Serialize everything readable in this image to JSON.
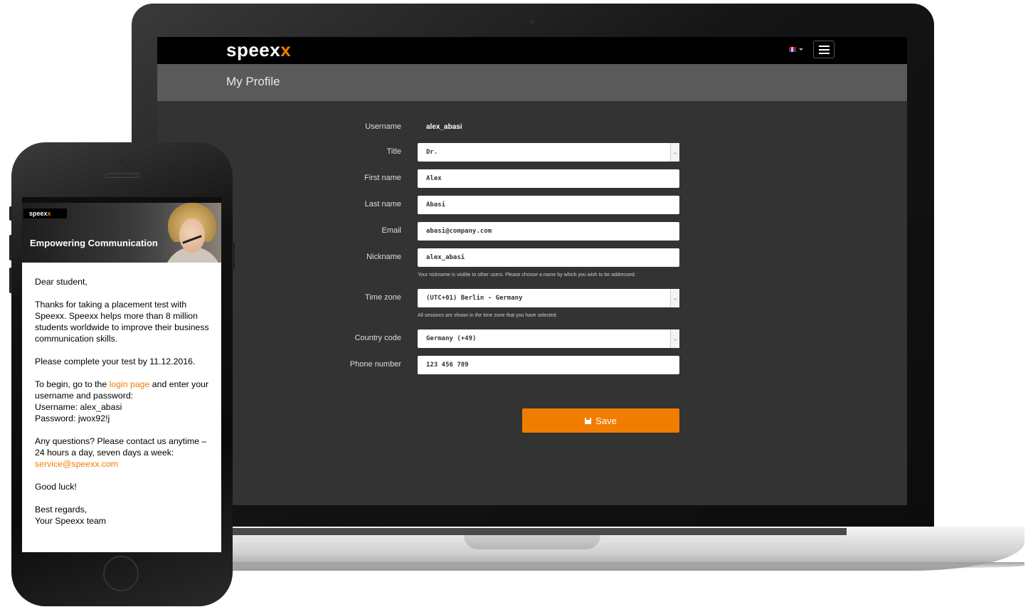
{
  "laptop": {
    "brand_logo": "speexx",
    "brand_logo_main": "speex",
    "brand_logo_accent": "x",
    "language_flag": "uk-flag-icon",
    "menu_icon": "hamburger-icon",
    "page_title": "My Profile",
    "form": {
      "username_label": "Username",
      "username_value": "alex_abasi",
      "title_label": "Title",
      "title_value": "Dr.",
      "first_name_label": "First name",
      "first_name_value": "Alex",
      "last_name_label": "Last name",
      "last_name_value": "Abasi",
      "email_label": "Email",
      "email_value": "abasi@company.com",
      "nickname_label": "Nickname",
      "nickname_value": "alex_abasi",
      "nickname_help": "Your nickname is visible to other users. Please choose a name by which you wish to be addressed.",
      "timezone_label": "Time zone",
      "timezone_value": "(UTC+01) Berlin - Germany",
      "timezone_help": "All sessions are shown in the time zone that you have selected.",
      "country_code_label": "Country code",
      "country_code_value": "Germany (+49)",
      "phone_label": "Phone number",
      "phone_value": "123 456 789",
      "save_label": "Save"
    },
    "colors": {
      "accent": "#f07d00",
      "nav_bg": "#000000",
      "header_bg": "#5a5a5a",
      "body_bg": "#333333"
    }
  },
  "phone": {
    "email_logo_main": "speex",
    "email_logo_accent": "x",
    "tagline": "Empowering Communication",
    "greeting": "Dear student,",
    "intro": "Thanks for taking a placement test with Speexx. Speexx helps more than 8 million students worldwide to improve their business communication skills.",
    "deadline": "Please complete your test by 11.12.2016.",
    "begin_prefix": "To begin, go to the ",
    "login_link": "login page",
    "begin_suffix": " and enter your username and password:",
    "username_line": "Username: alex_abasi",
    "password_line": "Password: jwox92!j",
    "questions_text": "Any questions? Please contact us anytime – 24 hours a day, seven days a week: ",
    "service_email": "service@speexx.com",
    "good_luck": "Good luck!",
    "regards": "Best regards,",
    "signature": "Your Speexx team"
  }
}
